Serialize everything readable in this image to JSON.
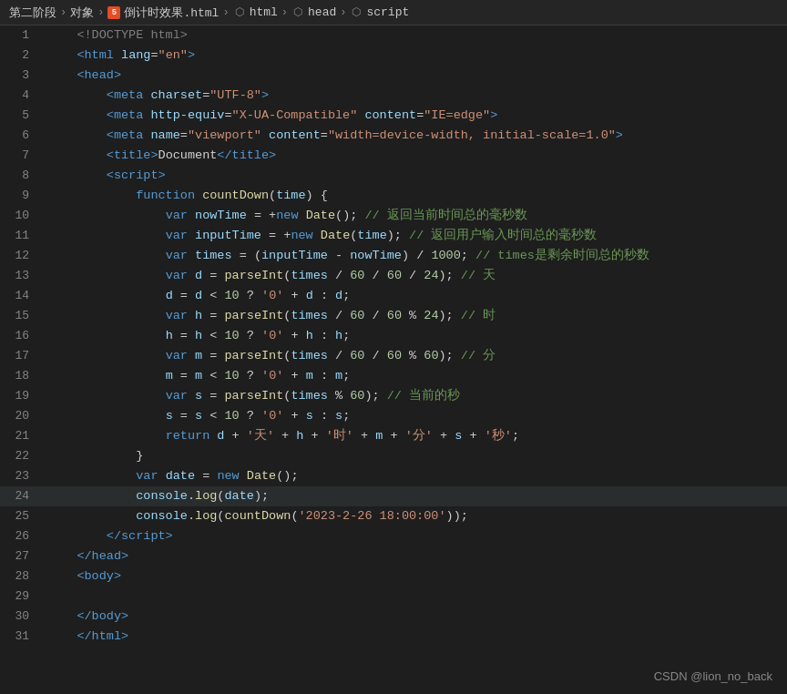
{
  "breadcrumb": {
    "items": [
      {
        "label": "第二阶段",
        "icon": "none"
      },
      {
        "label": "对象",
        "icon": "none"
      },
      {
        "label": "倒计时效果.html",
        "icon": "html"
      },
      {
        "label": "html",
        "icon": "tag"
      },
      {
        "label": "head",
        "icon": "tag"
      },
      {
        "label": "script",
        "icon": "tag"
      }
    ]
  },
  "lines": [
    {
      "num": 1,
      "html": "<span class='plain'>    </span><span class='doctype'>&lt;!DOCTYPE html&gt;</span>"
    },
    {
      "num": 2,
      "html": "<span class='plain'>    </span><span class='tag'>&lt;html</span> <span class='attr'>lang</span>=<span class='attrval'>\"en\"</span><span class='tag'>&gt;</span>"
    },
    {
      "num": 3,
      "html": "<span class='plain'>    </span><span class='tag'>&lt;head&gt;</span>"
    },
    {
      "num": 4,
      "html": "<span class='plain'>        </span><span class='tag'>&lt;meta</span> <span class='attr'>charset</span>=<span class='attrval'>\"UTF-8\"</span><span class='tag'>&gt;</span>"
    },
    {
      "num": 5,
      "html": "<span class='plain'>        </span><span class='tag'>&lt;meta</span> <span class='attr'>http-equiv</span>=<span class='attrval'>\"X-UA-Compatible\"</span> <span class='attr'>content</span>=<span class='attrval'>\"IE=edge\"</span><span class='tag'>&gt;</span>"
    },
    {
      "num": 6,
      "html": "<span class='plain'>        </span><span class='tag'>&lt;meta</span> <span class='attr'>name</span>=<span class='attrval'>\"viewport\"</span> <span class='attr'>content</span>=<span class='attrval'>\"width=device-width, initial-scale=1.0\"</span><span class='tag'>&gt;</span>"
    },
    {
      "num": 7,
      "html": "<span class='plain'>        </span><span class='tag'>&lt;title&gt;</span><span class='plain'>Document</span><span class='tag'>&lt;/title&gt;</span>"
    },
    {
      "num": 8,
      "html": "<span class='plain'>        </span><span class='tag'>&lt;script&gt;</span>"
    },
    {
      "num": 9,
      "html": "<span class='plain'>            </span><span class='kw'>function</span> <span class='fn'>countDown</span><span class='punct'>(</span><span class='var'>time</span><span class='punct'>) {</span>"
    },
    {
      "num": 10,
      "html": "<span class='plain'>                </span><span class='kw'>var</span> <span class='var'>nowTime</span> <span class='op'>=</span> <span class='op'>+</span><span class='kw'>new</span> <span class='fn'>Date</span><span class='punct'>();</span> <span class='comment'>// 返回当前时间总的毫秒数</span>"
    },
    {
      "num": 11,
      "html": "<span class='plain'>                </span><span class='kw'>var</span> <span class='var'>inputTime</span> <span class='op'>=</span> <span class='op'>+</span><span class='kw'>new</span> <span class='fn'>Date</span><span class='punct'>(</span><span class='var'>time</span><span class='punct'>);</span> <span class='comment'>// 返回用户输入时间总的毫秒数</span>"
    },
    {
      "num": 12,
      "html": "<span class='plain'>                </span><span class='kw'>var</span> <span class='var'>times</span> <span class='op'>=</span> <span class='punct'>(</span><span class='var'>inputTime</span> <span class='op'>-</span> <span class='var'>nowTime</span><span class='punct'>)</span> <span class='op'>/</span> <span class='num'>1000</span><span class='punct'>;</span> <span class='comment'>// times是剩余时间总的秒数</span>"
    },
    {
      "num": 13,
      "html": "<span class='plain'>                </span><span class='kw'>var</span> <span class='var'>d</span> <span class='op'>=</span> <span class='fn'>parseInt</span><span class='punct'>(</span><span class='var'>times</span> <span class='op'>/</span> <span class='num'>60</span> <span class='op'>/</span> <span class='num'>60</span> <span class='op'>/</span> <span class='num'>24</span><span class='punct'>);</span> <span class='comment'>// 天</span>"
    },
    {
      "num": 14,
      "html": "<span class='plain'>                </span><span class='var'>d</span> <span class='op'>=</span> <span class='var'>d</span> <span class='op'>&lt;</span> <span class='num'>10</span> <span class='op'>?</span> <span class='str'>'0'</span> <span class='op'>+</span> <span class='var'>d</span> <span class='op'>:</span> <span class='var'>d</span><span class='punct'>;</span>"
    },
    {
      "num": 15,
      "html": "<span class='plain'>                </span><span class='kw'>var</span> <span class='var'>h</span> <span class='op'>=</span> <span class='fn'>parseInt</span><span class='punct'>(</span><span class='var'>times</span> <span class='op'>/</span> <span class='num'>60</span> <span class='op'>/</span> <span class='num'>60</span> <span class='op'>%</span> <span class='num'>24</span><span class='punct'>);</span> <span class='comment'>// 时</span>"
    },
    {
      "num": 16,
      "html": "<span class='plain'>                </span><span class='var'>h</span> <span class='op'>=</span> <span class='var'>h</span> <span class='op'>&lt;</span> <span class='num'>10</span> <span class='op'>?</span> <span class='str'>'0'</span> <span class='op'>+</span> <span class='var'>h</span> <span class='op'>:</span> <span class='var'>h</span><span class='punct'>;</span>"
    },
    {
      "num": 17,
      "html": "<span class='plain'>                </span><span class='kw'>var</span> <span class='var'>m</span> <span class='op'>=</span> <span class='fn'>parseInt</span><span class='punct'>(</span><span class='var'>times</span> <span class='op'>/</span> <span class='num'>60</span> <span class='op'>/</span> <span class='num'>60</span> <span class='op'>%</span> <span class='num'>60</span><span class='punct'>);</span> <span class='comment'>// 分</span>"
    },
    {
      "num": 18,
      "html": "<span class='plain'>                </span><span class='var'>m</span> <span class='op'>=</span> <span class='var'>m</span> <span class='op'>&lt;</span> <span class='num'>10</span> <span class='op'>?</span> <span class='str'>'0'</span> <span class='op'>+</span> <span class='var'>m</span> <span class='op'>:</span> <span class='var'>m</span><span class='punct'>;</span>"
    },
    {
      "num": 19,
      "html": "<span class='plain'>                </span><span class='kw'>var</span> <span class='var'>s</span> <span class='op'>=</span> <span class='fn'>parseInt</span><span class='punct'>(</span><span class='var'>times</span> <span class='op'>%</span> <span class='num'>60</span><span class='punct'>);</span> <span class='comment'>// 当前的秒</span>"
    },
    {
      "num": 20,
      "html": "<span class='plain'>                </span><span class='var'>s</span> <span class='op'>=</span> <span class='var'>s</span> <span class='op'>&lt;</span> <span class='num'>10</span> <span class='op'>?</span> <span class='str'>'0'</span> <span class='op'>+</span> <span class='var'>s</span> <span class='op'>:</span> <span class='var'>s</span><span class='punct'>;</span>"
    },
    {
      "num": 21,
      "html": "<span class='plain'>                </span><span class='kw'>return</span> <span class='var'>d</span> <span class='op'>+</span> <span class='str'>'天'</span> <span class='op'>+</span> <span class='var'>h</span> <span class='op'>+</span> <span class='str'>'时'</span> <span class='op'>+</span> <span class='var'>m</span> <span class='op'>+</span> <span class='str'>'分'</span> <span class='op'>+</span> <span class='var'>s</span> <span class='op'>+</span> <span class='str'>'秒'</span><span class='punct'>;</span>"
    },
    {
      "num": 22,
      "html": "<span class='plain'>            </span><span class='punct'>}</span>"
    },
    {
      "num": 23,
      "html": "<span class='plain'>            </span><span class='kw'>var</span> <span class='var'>date</span> <span class='op'>=</span> <span class='kw'>new</span> <span class='fn'>Date</span><span class='punct'>();</span>"
    },
    {
      "num": 24,
      "html": "<span class='plain'>            </span><span class='var'>console</span><span class='punct'>.</span><span class='method'>log</span><span class='punct'>(</span><span class='var'>date</span><span class='punct'>);</span>",
      "highlighted": true
    },
    {
      "num": 25,
      "html": "<span class='plain'>            </span><span class='var'>console</span><span class='punct'>.</span><span class='method'>log</span><span class='punct'>(</span><span class='fn'>countDown</span><span class='punct'>(</span><span class='str'>'2023-2-26 18:00:00'</span><span class='punct'>));</span>"
    },
    {
      "num": 26,
      "html": "<span class='plain'>        </span><span class='tag'>&lt;/script&gt;</span>"
    },
    {
      "num": 27,
      "html": "<span class='plain'>    </span><span class='tag'>&lt;/head&gt;</span>"
    },
    {
      "num": 28,
      "html": "<span class='plain'>    </span><span class='tag'>&lt;body&gt;</span>"
    },
    {
      "num": 29,
      "html": ""
    },
    {
      "num": 30,
      "html": "<span class='plain'>    </span><span class='tag'>&lt;/body&gt;</span>"
    },
    {
      "num": 31,
      "html": "<span class='plain'>    </span><span class='tag'>&lt;/html&gt;</span>"
    }
  ],
  "footer": {
    "watermark": "CSDN @lion_no_back"
  }
}
